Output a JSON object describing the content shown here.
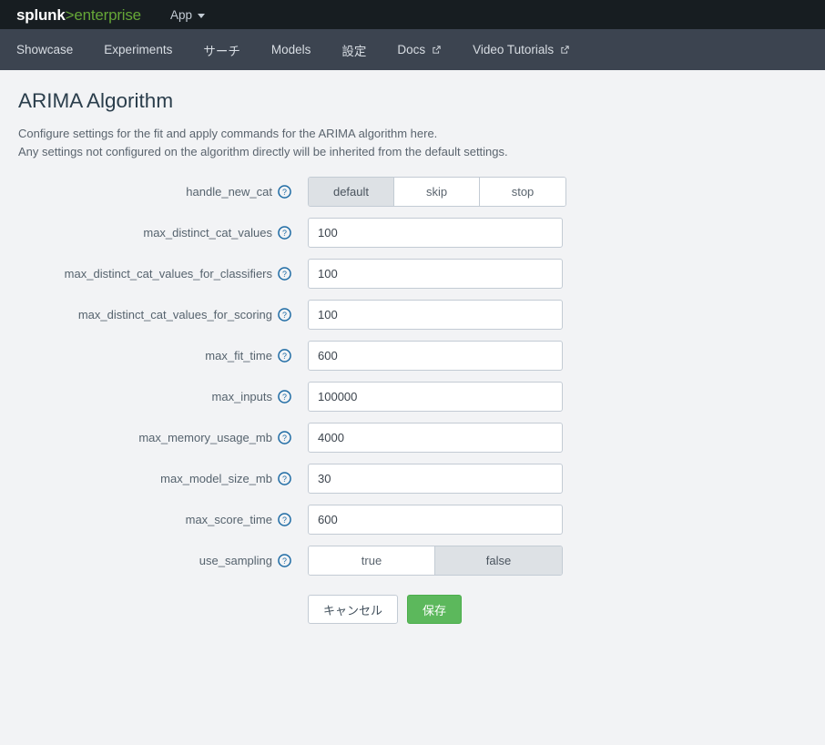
{
  "topbar": {
    "logo_main": "splunk",
    "logo_sep": ">",
    "logo_sub": "enterprise",
    "app_menu_label": "App",
    "background": "#171d21",
    "accent_green": "#65a637"
  },
  "nav": {
    "background": "#3c4450",
    "items": [
      {
        "label": "Showcase",
        "external": false
      },
      {
        "label": "Experiments",
        "external": false
      },
      {
        "label": "サーチ",
        "external": false
      },
      {
        "label": "Models",
        "external": false
      },
      {
        "label": "設定",
        "external": false
      },
      {
        "label": "Docs",
        "external": true
      },
      {
        "label": "Video Tutorials",
        "external": true
      }
    ]
  },
  "page": {
    "title": "ARIMA Algorithm",
    "description_line1": "Configure settings for the fit and apply commands for the ARIMA algorithm here.",
    "description_line2": "Any settings not configured on the algorithm directly will be inherited from the default settings."
  },
  "form": {
    "fields": [
      {
        "name": "handle_new_cat",
        "label": "handle_new_cat",
        "type": "buttongroup",
        "options": [
          "default",
          "skip",
          "stop"
        ],
        "selected": "default",
        "help": "help-icon"
      },
      {
        "name": "max_distinct_cat_values",
        "label": "max_distinct_cat_values",
        "type": "text",
        "value": "100",
        "help": "help-icon"
      },
      {
        "name": "max_distinct_cat_values_for_classifiers",
        "label": "max_distinct_cat_values_for_classifiers",
        "type": "text",
        "value": "100",
        "help": "help-icon"
      },
      {
        "name": "max_distinct_cat_values_for_scoring",
        "label": "max_distinct_cat_values_for_scoring",
        "type": "text",
        "value": "100",
        "help": "help-icon"
      },
      {
        "name": "max_fit_time",
        "label": "max_fit_time",
        "type": "text",
        "value": "600",
        "help": "help-icon"
      },
      {
        "name": "max_inputs",
        "label": "max_inputs",
        "type": "text",
        "value": "100000",
        "help": "help-icon"
      },
      {
        "name": "max_memory_usage_mb",
        "label": "max_memory_usage_mb",
        "type": "text",
        "value": "4000",
        "help": "help-icon"
      },
      {
        "name": "max_model_size_mb",
        "label": "max_model_size_mb",
        "type": "text",
        "value": "30",
        "help": "help-icon"
      },
      {
        "name": "max_score_time",
        "label": "max_score_time",
        "type": "text",
        "value": "600",
        "help": "help-icon"
      },
      {
        "name": "use_sampling",
        "label": "use_sampling",
        "type": "buttongroup",
        "options": [
          "true",
          "false"
        ],
        "selected": "false",
        "help": "help-icon"
      }
    ]
  },
  "actions": {
    "cancel_label": "キャンセル",
    "save_label": "保存",
    "save_color": "#5cb85c"
  },
  "colors": {
    "body_background": "#f2f3f5",
    "input_border": "#c3cbd4",
    "selected_segment": "#dde1e5",
    "help_icon_blue": "#1e6ba4",
    "title_text": "#2b3e4c",
    "label_text": "#56636e"
  }
}
